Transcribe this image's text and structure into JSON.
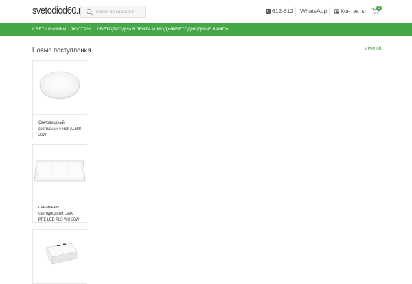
{
  "header": {
    "logo": "svetodiod60.ru",
    "search_placeholder": "Поиск по каталогу",
    "phone": "612-612",
    "whatsapp": "WhatsApp",
    "contacts": "Контакты",
    "cart_count": "0"
  },
  "nav": {
    "items": [
      {
        "label": "Светильники"
      },
      {
        "label": "Люстры"
      },
      {
        "label": "Светодиодная лента и модули"
      },
      {
        "label": "Светодиодные лампы"
      }
    ]
  },
  "section": {
    "title": "Новые поступления",
    "view_all": "View all"
  },
  "products": [
    {
      "name": "Светодиодный светильник Feron AL508 20W",
      "image_icon": "round-panel-light"
    },
    {
      "name": "Светильник светодиодный Leek PRE LED PLS WH 36W",
      "image_icon": "square-panel-light"
    },
    {
      "name": "",
      "image_icon": "square-surface-light"
    }
  ],
  "colors": {
    "accent": "#45a846",
    "nav_text": "#ffffff"
  }
}
